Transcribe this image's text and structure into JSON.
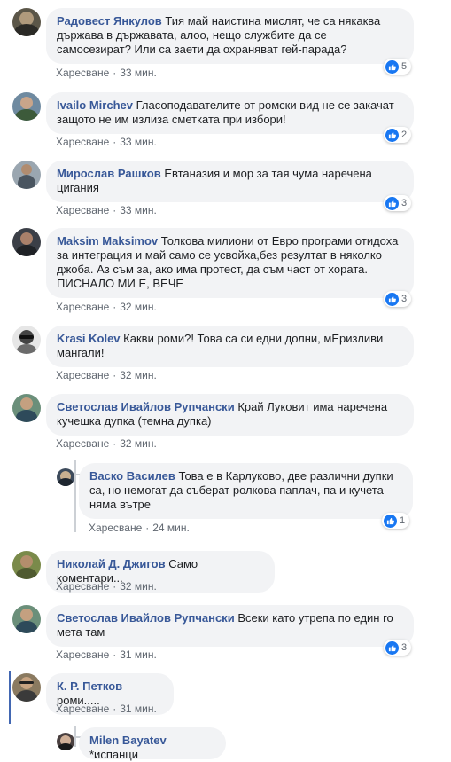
{
  "comments": [
    {
      "author": "Радовест Янкулов",
      "text": "Тия май наистина мислят, че са някаква държава в държавата, алоо, нещо службите да се самосезират? Или са заети да охраняват гей-парада?",
      "like_label": "Харесване",
      "time": "33 мин.",
      "reactions": "5"
    },
    {
      "author": "Ivailo Mirchev",
      "text": "Гласоподавателите от ромски вид не се закачат защото не им излиза сметката при избори!",
      "like_label": "Харесване",
      "time": "33 мин.",
      "reactions": "2"
    },
    {
      "author": "Мирослав Рашков",
      "text": "Евтаназия и мор за тая чума наречена цигания",
      "like_label": "Харесване",
      "time": "33 мин.",
      "reactions": "3"
    },
    {
      "author": "Maksim Maksimov",
      "text": "Толкова милиони от Евро програми отидоха за интеграция и май само се усвойха,без резултат в няколко джоба. Аз съм за, ако има протест, да съм част от хората. ПИСНАЛО МИ Е, ВЕЧЕ",
      "like_label": "Харесване",
      "time": "32 мин.",
      "reactions": "3"
    },
    {
      "author": "Krasi Kolev",
      "text": "Какви роми?! Това са си едни долни, мЕризливи мангали!",
      "like_label": "Харесване",
      "time": "32 мин.",
      "reactions": ""
    },
    {
      "author": "Светослав Ивайлов Рупчански",
      "text": "Край Луковит има наречена кучешка дупка (темна дупка)",
      "like_label": "Харесване",
      "time": "32 мин.",
      "reactions": ""
    },
    {
      "author": "Васко Василев",
      "text": "Това е в Карлуково, две различни дупки са, но немогат да съберат ролкова паплач, па и кучета няма вътре",
      "like_label": "Харесване",
      "time": "24 мин.",
      "reactions": "1"
    },
    {
      "author": "Николай Д. Джигов",
      "text": "Само коментари...",
      "like_label": "Харесване",
      "time": "32 мин.",
      "reactions": ""
    },
    {
      "author": "Светослав Ивайлов Рупчански",
      "text": "Всеки като утрепа по един го мета там",
      "like_label": "Харесване",
      "time": "31 мин.",
      "reactions": "3"
    },
    {
      "author": "К. Р. Петков",
      "text": "роми.....",
      "like_label": "Харесване",
      "time": "31 мин.",
      "reactions": ""
    },
    {
      "author": "Milen Bayatev",
      "text": "*испанци",
      "like_label": "",
      "time": "",
      "reactions": ""
    }
  ],
  "colors": {
    "author": "#385898",
    "bubble": "#f2f3f5",
    "meta": "#606770",
    "like_blue": "#1877f2",
    "thread_line": "#ccd0d5",
    "thread_active": "#4267b2"
  }
}
